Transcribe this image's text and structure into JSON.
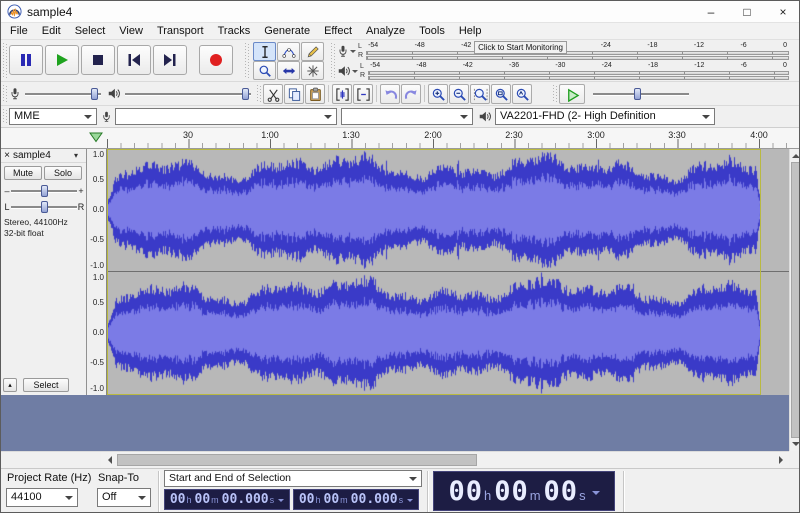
{
  "window": {
    "title": "sample4",
    "minimize": "–",
    "maximize": "□",
    "close": "×"
  },
  "menubar": {
    "items": [
      "File",
      "Edit",
      "Select",
      "View",
      "Transport",
      "Tracks",
      "Generate",
      "Effect",
      "Analyze",
      "Tools",
      "Help"
    ]
  },
  "meters": {
    "recording": {
      "hint": "Click to Start Monitoring",
      "channel_labels": [
        "L",
        "R"
      ],
      "scale": [
        "-54",
        "-48",
        "-42",
        "-36",
        "-30",
        "-24",
        "-18",
        "-12",
        "-6",
        "0"
      ]
    },
    "playback": {
      "channel_labels": [
        "L",
        "R"
      ],
      "scale": [
        "-54",
        "-48",
        "-42",
        "-36",
        "-30",
        "-24",
        "-18",
        "-12",
        "-6",
        "0"
      ]
    }
  },
  "devices": {
    "host": "MME",
    "recording_device": "",
    "recording_channels": "",
    "playback_device": "VA2201-FHD (2- High Definition"
  },
  "timeline": {
    "labels": [
      "30",
      "1:00",
      "1:30",
      "2:00",
      "2:30",
      "3:00",
      "3:30",
      "4:00"
    ]
  },
  "track": {
    "close": "×",
    "name": "sample4",
    "menu_arrow": "▾",
    "mute": "Mute",
    "solo": "Solo",
    "gain_min": "–",
    "gain_max": "+",
    "pan_left": "L",
    "pan_right": "R",
    "info_line1": "Stereo, 44100Hz",
    "info_line2": "32-bit float",
    "collapse": "▴",
    "select": "Select",
    "ruler_values": [
      "1.0",
      "0.5",
      "0.0",
      "-0.5",
      "-1.0"
    ]
  },
  "waveform": {
    "peak_color": "#3a3ac8",
    "rms_color": "#7b7be6",
    "background": "#b8b8b8",
    "seeds": [
      311,
      1777
    ]
  },
  "statusbar": {
    "project_rate_label": "Project Rate (Hz)",
    "project_rate": "44100",
    "snap_label": "Snap-To",
    "snap_value": "Off",
    "selection_mode": "Start and End of Selection",
    "sel_start": [
      {
        "digits": "00",
        "unit": "h"
      },
      {
        "digits": "00",
        "unit": "m"
      },
      {
        "digits": "00.000",
        "unit": "s"
      }
    ],
    "sel_end": [
      {
        "digits": "00",
        "unit": "h"
      },
      {
        "digits": "00",
        "unit": "m"
      },
      {
        "digits": "00.000",
        "unit": "s"
      }
    ],
    "big_time": [
      {
        "digits": "00",
        "unit": "h"
      },
      {
        "digits": "00",
        "unit": "m"
      },
      {
        "digits": "00",
        "unit": "s"
      }
    ]
  }
}
